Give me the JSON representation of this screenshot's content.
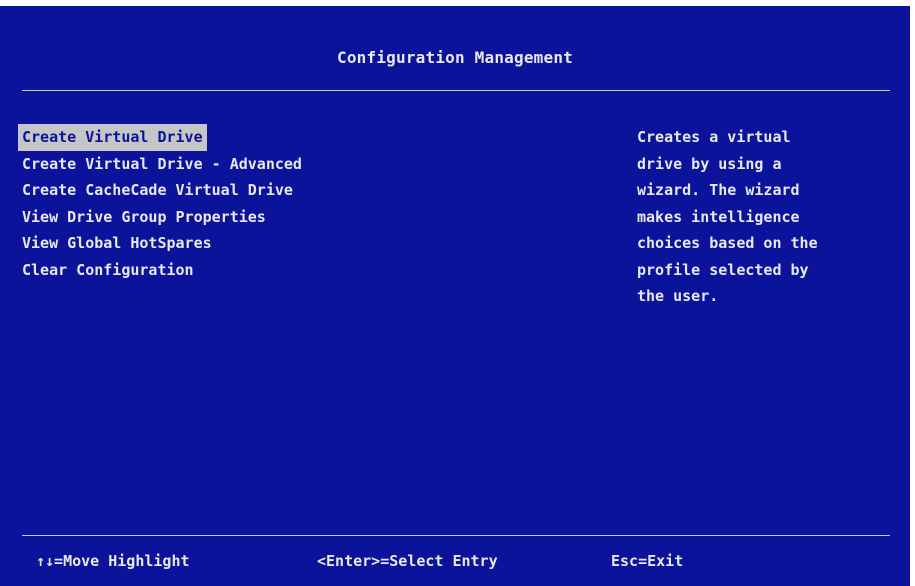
{
  "title": "Configuration Management",
  "menu": {
    "items": [
      {
        "label": "Create Virtual Drive",
        "selected": true
      },
      {
        "label": "Create Virtual Drive - Advanced",
        "selected": false
      },
      {
        "label": "Create CacheCade Virtual Drive",
        "selected": false
      },
      {
        "label": "View Drive Group Properties",
        "selected": false
      },
      {
        "label": "View Global HotSpares",
        "selected": false
      },
      {
        "label": "Clear Configuration",
        "selected": false
      }
    ]
  },
  "help": {
    "lines": [
      "Creates a virtual",
      "drive by using a",
      "wizard. The wizard",
      "makes intelligence",
      "choices based on the",
      "profile selected by",
      "the user."
    ]
  },
  "footer": {
    "move_highlight": "↑↓=Move Highlight",
    "select_entry": "<Enter>=Select Entry",
    "exit": "Esc=Exit"
  },
  "colors": {
    "background": "#0a139a",
    "text": "#e8e8ef",
    "highlight_bg": "#c6c6c6",
    "highlight_text": "#0a139a"
  }
}
